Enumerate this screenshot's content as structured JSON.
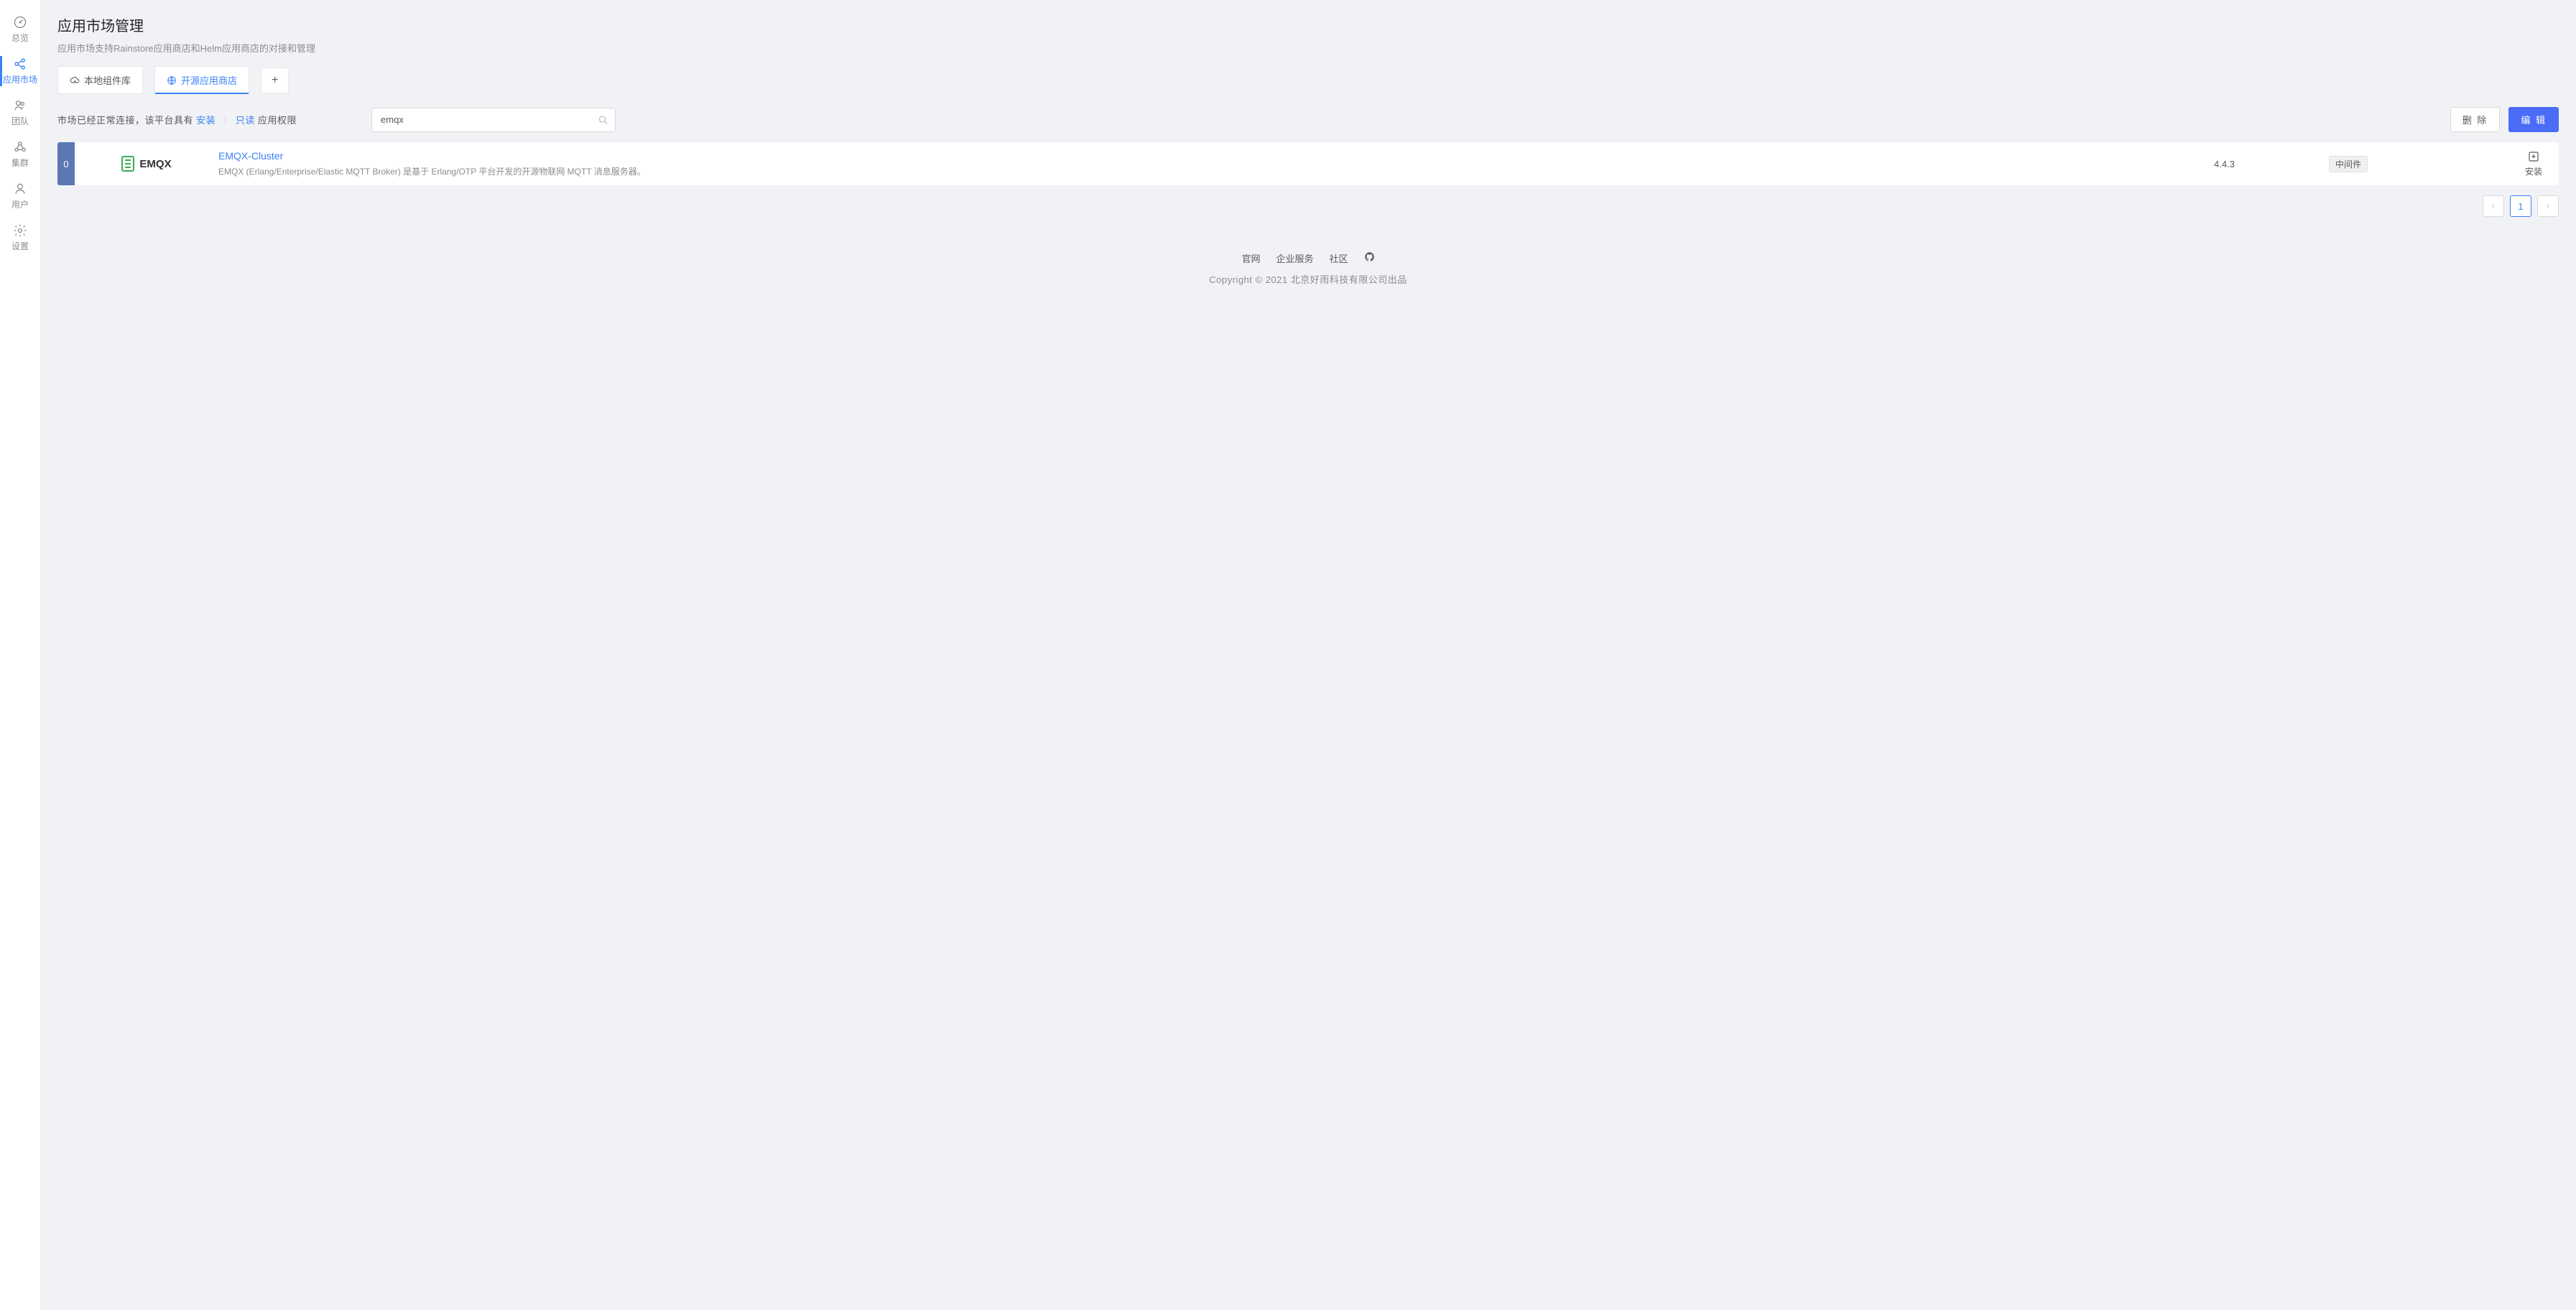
{
  "sidebar": {
    "items": [
      {
        "label": "总览"
      },
      {
        "label": "应用市场"
      },
      {
        "label": "团队"
      },
      {
        "label": "集群"
      },
      {
        "label": "用户"
      },
      {
        "label": "设置"
      }
    ]
  },
  "page": {
    "title": "应用市场管理",
    "description": "应用市场支持Rainstore应用商店和Helm应用商店的对接和管理"
  },
  "tabs": {
    "local": "本地组件库",
    "openstore": "开源应用商店"
  },
  "status": {
    "prefix": "市场已经正常连接，该平台具有 ",
    "perm_install": "安装",
    "divider": "｜",
    "perm_readonly": "只读",
    "suffix": " 应用权限"
  },
  "search": {
    "value": "emqx"
  },
  "buttons": {
    "delete": "删 除",
    "edit": "编 辑"
  },
  "list": {
    "items": [
      {
        "index": "0",
        "logo_text": "EMQX",
        "title": "EMQX-Cluster",
        "description": "EMQX (Erlang/Enterprise/Elastic MQTT Broker) 是基于 Erlang/OTP 平台开发的开源物联网 MQTT 消息服务器。",
        "version": "4.4.3",
        "tag": "中间件",
        "install_label": "安装"
      }
    ]
  },
  "pagination": {
    "current": "1"
  },
  "footer": {
    "links": {
      "official": "官网",
      "enterprise": "企业服务",
      "community": "社区"
    },
    "copyright": "Copyright © 2021 北京好雨科技有限公司出品"
  }
}
